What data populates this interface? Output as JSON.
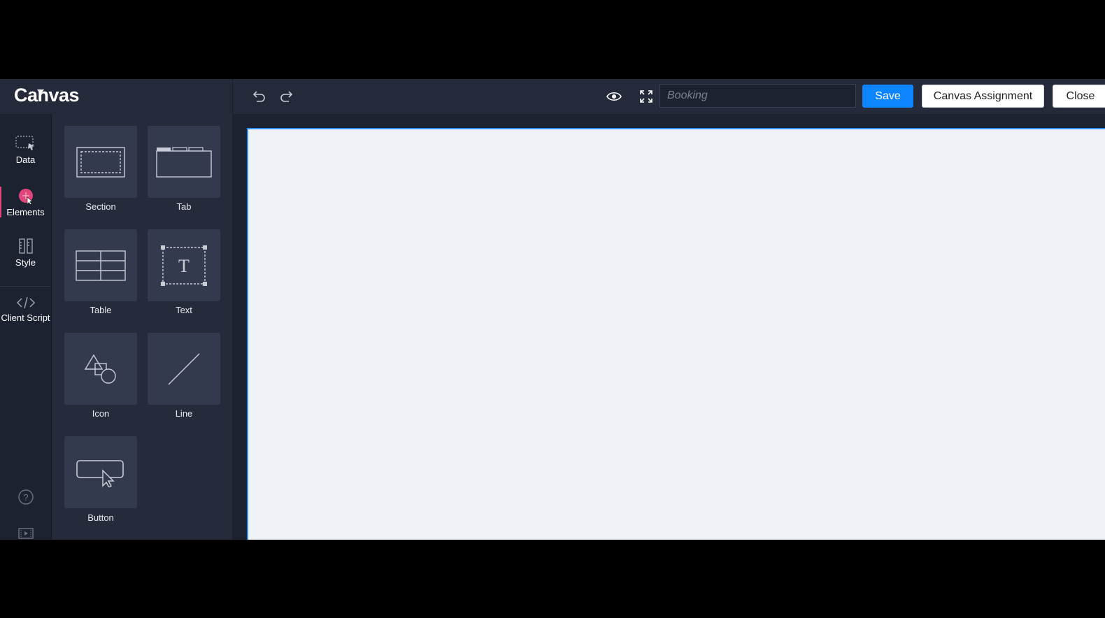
{
  "app": {
    "brand": "Canvas"
  },
  "toolbar": {
    "search_placeholder": "Booking",
    "save_label": "Save",
    "assignment_label": "Canvas Assignment",
    "close_label": "Close",
    "icons": [
      "undo-icon",
      "redo-icon",
      "eye-icon",
      "expand-icon"
    ]
  },
  "sidebar": {
    "items": [
      {
        "label": "Data",
        "icon": "data-icon"
      },
      {
        "label": "Elements",
        "icon": "plus-circle-icon",
        "active": true
      },
      {
        "label": "Style",
        "icon": "style-icon"
      },
      {
        "label": "Client Script",
        "icon": "code-icon"
      }
    ],
    "bottom_icons": [
      "help-icon",
      "video-icon"
    ]
  },
  "elements_panel": {
    "tiles": [
      {
        "label": "Section",
        "icon": "section-icon"
      },
      {
        "label": "Tab",
        "icon": "tab-icon"
      },
      {
        "label": "Table",
        "icon": "table-icon"
      },
      {
        "label": "Text",
        "icon": "text-icon"
      },
      {
        "label": "Icon",
        "icon": "shapes-icon"
      },
      {
        "label": "Line",
        "icon": "line-icon"
      },
      {
        "label": "Button",
        "icon": "button-icon"
      }
    ]
  },
  "colors": {
    "accent": "#0d85ff",
    "active_indicator": "#e0457b",
    "canvas_bg": "#eff3f8"
  }
}
